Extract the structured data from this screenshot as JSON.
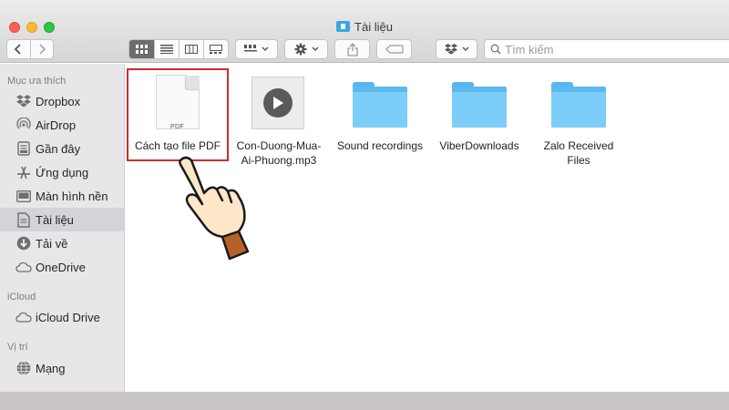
{
  "window": {
    "title": "Tài liệu"
  },
  "toolbar": {
    "back_icon": "chevron-left-icon",
    "forward_icon": "chevron-right-icon",
    "view_modes": [
      "icon-view",
      "list-view",
      "column-view",
      "gallery-view"
    ],
    "active_view": "icon-view",
    "search_placeholder": "Tìm kiếm"
  },
  "sidebar": {
    "sections": [
      {
        "title": "Mục ưa thích",
        "items": [
          {
            "label": "Dropbox",
            "icon": "dropbox-icon"
          },
          {
            "label": "AirDrop",
            "icon": "airdrop-icon"
          },
          {
            "label": "Gần đây",
            "icon": "recents-icon"
          },
          {
            "label": "Ứng dụng",
            "icon": "applications-icon"
          },
          {
            "label": "Màn hình nền",
            "icon": "desktop-icon"
          },
          {
            "label": "Tài liệu",
            "icon": "documents-icon",
            "active": true
          },
          {
            "label": "Tải về",
            "icon": "downloads-icon"
          },
          {
            "label": "OneDrive",
            "icon": "cloud-icon"
          }
        ]
      },
      {
        "title": "iCloud",
        "items": [
          {
            "label": "iCloud Drive",
            "icon": "cloud-icon"
          }
        ]
      },
      {
        "title": "Vị trí",
        "items": [
          {
            "label": "Mạng",
            "icon": "network-icon"
          }
        ]
      }
    ]
  },
  "files": [
    {
      "name": "Cách tạo file PDF",
      "type": "pdf",
      "selected": true,
      "badge": "PDF"
    },
    {
      "name_line1": "Con-Duong-Mua-",
      "name_line2": "Ai-Phuong.mp3",
      "type": "mp3"
    },
    {
      "name": "Sound recordings",
      "type": "folder"
    },
    {
      "name": "ViberDownloads",
      "type": "folder"
    },
    {
      "name_line1": "Zalo Received",
      "name_line2": "Files",
      "type": "folder"
    }
  ],
  "colors": {
    "selection_outline": "#d22b2b",
    "folder": "#6cc3f5",
    "sidebar_bg": "#e7e6e9"
  }
}
